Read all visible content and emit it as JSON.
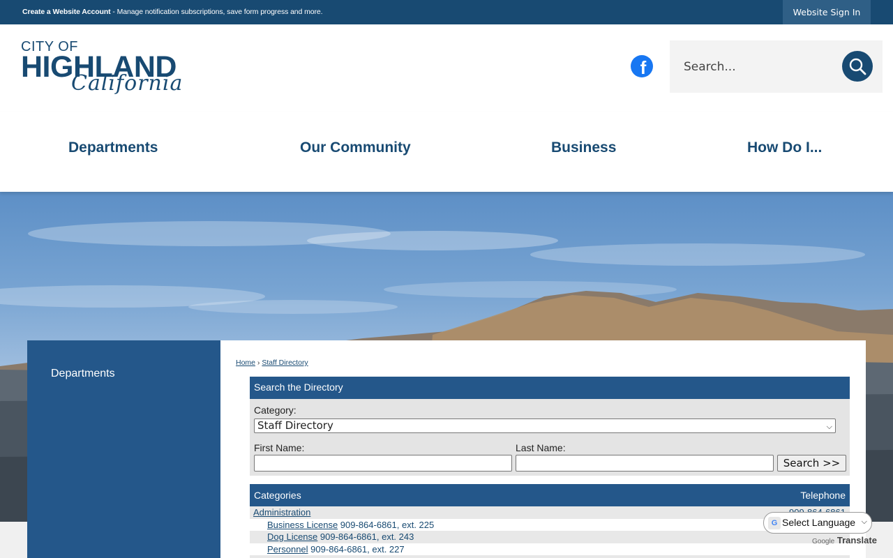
{
  "topbar": {
    "create_account": "Create a Website Account",
    "message": " - Manage notification subscriptions, save form progress and more.",
    "signin": "Website Sign In"
  },
  "logo": {
    "line1": "CITY OF",
    "line2": "HIGHLAND",
    "line3": "California"
  },
  "social": {
    "facebook_glyph": "f"
  },
  "search": {
    "placeholder": "Search..."
  },
  "nav": {
    "items": [
      "Departments",
      "Our Community",
      "Business",
      "How Do I..."
    ]
  },
  "sidebar": {
    "item": "Departments"
  },
  "breadcrumb": {
    "home": "Home",
    "sep": " › ",
    "current": "Staff Directory"
  },
  "directory": {
    "heading": "Search the Directory",
    "category_label": "Category:",
    "category_value": "Staff Directory",
    "first_name_label": "First Name:",
    "last_name_label": "Last Name:",
    "search_button": "Search >>"
  },
  "categories": {
    "heading": "Categories",
    "phone_heading": "Telephone",
    "rows": [
      {
        "name": "Administration",
        "phone": "909-864-6861"
      },
      {
        "name": "Business License",
        "phone": "909-864-6861, ext. 225"
      },
      {
        "name": "Dog License",
        "phone": "909-864-6861, ext. 243"
      },
      {
        "name": "Personnel",
        "phone": "909-864-6861, ext. 227"
      }
    ]
  },
  "translate": {
    "select_label": "Select Language",
    "powered_by": "Google",
    "translate_label": "Translate"
  },
  "colors": {
    "brand_dark": "#184a72",
    "brand_mid": "#24578a",
    "facebook": "#1877f2"
  }
}
